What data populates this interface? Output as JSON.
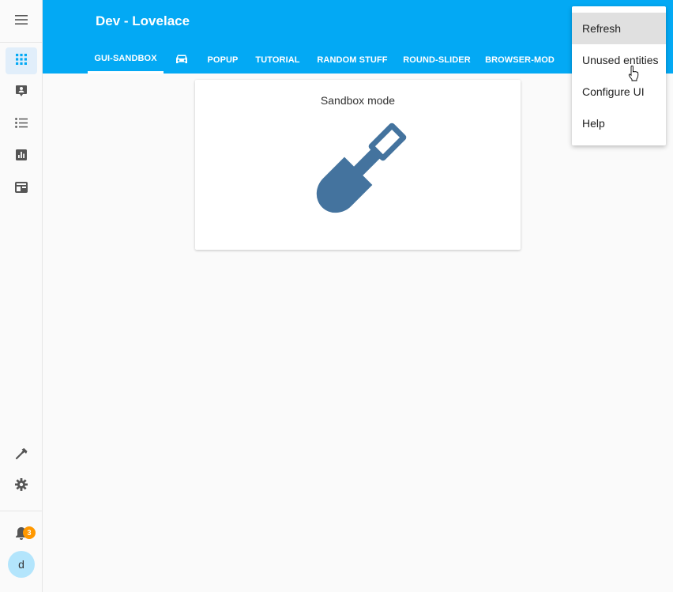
{
  "app": {
    "title": "Dev - Lovelace"
  },
  "sidebar": {
    "menu_icon": "hamburger-menu-icon",
    "items": [
      {
        "icon": "dashboard-grid-icon",
        "active": true
      },
      {
        "icon": "map-account-icon",
        "active": false
      },
      {
        "icon": "format-list-bulleted-icon",
        "active": false
      },
      {
        "icon": "chart-box-icon",
        "active": false
      },
      {
        "icon": "card-history-icon",
        "active": false
      }
    ],
    "bottom": [
      {
        "icon": "hammer-icon"
      },
      {
        "icon": "gear-icon"
      }
    ],
    "notifications": {
      "icon": "bell-icon",
      "count": "3"
    },
    "user": {
      "initial": "d"
    }
  },
  "tabs": [
    {
      "label": "GUI-SANDBOX",
      "active": true
    },
    {
      "label": "",
      "icon": "car-icon"
    },
    {
      "label": "POPUP"
    },
    {
      "label": "TUTORIAL"
    },
    {
      "label": "RANDOM STUFF"
    },
    {
      "label": "ROUND-SLIDER"
    },
    {
      "label": "BROWSER-MOD"
    }
  ],
  "card": {
    "title": "Sandbox mode",
    "icon": "shovel-icon",
    "icon_color": "#44739e"
  },
  "menu": {
    "items": [
      {
        "label": "Refresh",
        "hover": true
      },
      {
        "label": "Unused entities"
      },
      {
        "label": "Configure UI"
      },
      {
        "label": "Help"
      }
    ]
  },
  "colors": {
    "header": "#03a9f4",
    "active_nav_bg": "#e1eefa",
    "badge": "#ff9800"
  }
}
